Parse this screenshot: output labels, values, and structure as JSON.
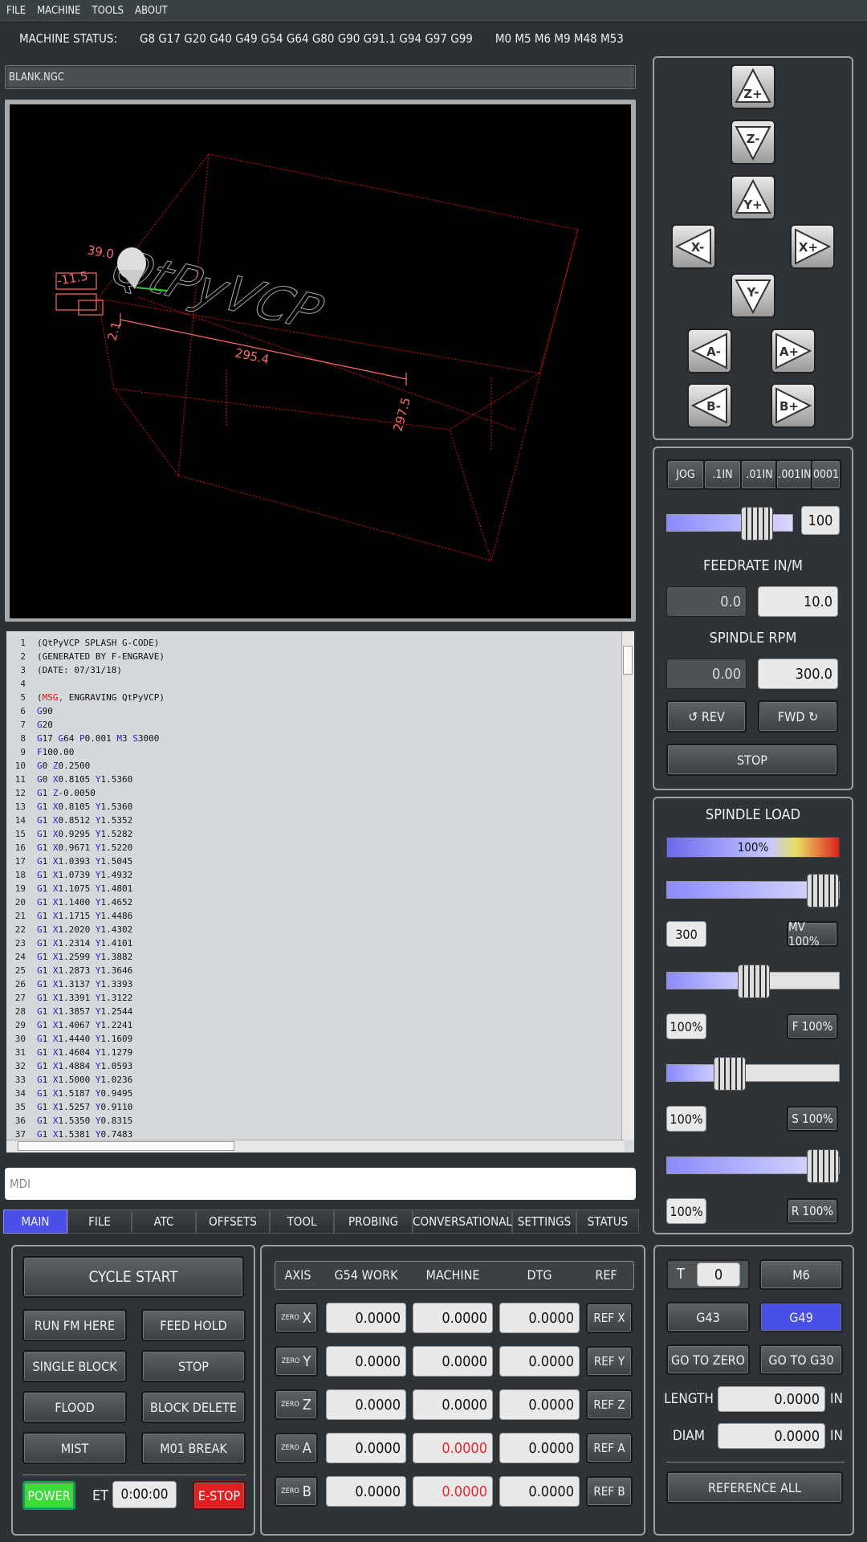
{
  "menu": [
    "FILE",
    "MACHINE",
    "TOOLS",
    "ABOUT"
  ],
  "status": {
    "label": "MACHINE STATUS:",
    "gcodes": "G8 G17 G20 G40 G49 G54 G64 G80 G90 G91.1 G94 G97 G99",
    "mcodes": "M0 M5 M6 M9 M48 M53"
  },
  "file_name": "BLANK.NGC",
  "preview": {
    "text": "QtPyVCP",
    "dims": [
      "39.0",
      "-11.5",
      "295.4",
      "297.5",
      "2.1"
    ]
  },
  "code_lines": [
    {
      "n": "1",
      "t": "(QtPyVCP SPLASH G-CODE)"
    },
    {
      "n": "2",
      "t": "(GENERATED BY F-ENGRAVE)"
    },
    {
      "n": "3",
      "t": "(DATE: 07/31/18)"
    },
    {
      "n": "4",
      "t": ""
    },
    {
      "n": "5",
      "t": "(MSG, ENGRAVING QtPyVCP)"
    },
    {
      "n": "6",
      "t": "G90"
    },
    {
      "n": "7",
      "t": "G20"
    },
    {
      "n": "8",
      "t": "G17 G64 P0.001 M3 S3000"
    },
    {
      "n": "9",
      "t": "F100.00"
    },
    {
      "n": "10",
      "t": "G0 Z0.2500"
    },
    {
      "n": "11",
      "t": "G0 X0.8105 Y1.5360"
    },
    {
      "n": "12",
      "t": "G1 Z-0.0050"
    },
    {
      "n": "13",
      "t": "G1 X0.8105 Y1.5360"
    },
    {
      "n": "14",
      "t": "G1 X0.8512 Y1.5352"
    },
    {
      "n": "15",
      "t": "G1 X0.9295 Y1.5282"
    },
    {
      "n": "16",
      "t": "G1 X0.9671 Y1.5220"
    },
    {
      "n": "17",
      "t": "G1 X1.0393 Y1.5045"
    },
    {
      "n": "18",
      "t": "G1 X1.0739 Y1.4932"
    },
    {
      "n": "19",
      "t": "G1 X1.1075 Y1.4801"
    },
    {
      "n": "20",
      "t": "G1 X1.1400 Y1.4652"
    },
    {
      "n": "21",
      "t": "G1 X1.1715 Y1.4486"
    },
    {
      "n": "22",
      "t": "G1 X1.2020 Y1.4302"
    },
    {
      "n": "23",
      "t": "G1 X1.2314 Y1.4101"
    },
    {
      "n": "24",
      "t": "G1 X1.2599 Y1.3882"
    },
    {
      "n": "25",
      "t": "G1 X1.2873 Y1.3646"
    },
    {
      "n": "26",
      "t": "G1 X1.3137 Y1.3393"
    },
    {
      "n": "27",
      "t": "G1 X1.3391 Y1.3122"
    },
    {
      "n": "28",
      "t": "G1 X1.3857 Y1.2544"
    },
    {
      "n": "29",
      "t": "G1 X1.4067 Y1.2241"
    },
    {
      "n": "30",
      "t": "G1 X1.4440 Y1.1609"
    },
    {
      "n": "31",
      "t": "G1 X1.4604 Y1.1279"
    },
    {
      "n": "32",
      "t": "G1 X1.4884 Y1.0593"
    },
    {
      "n": "33",
      "t": "G1 X1.5000 Y1.0236"
    },
    {
      "n": "34",
      "t": "G1 X1.5187 Y0.9495"
    },
    {
      "n": "35",
      "t": "G1 X1.5257 Y0.9110"
    },
    {
      "n": "36",
      "t": "G1 X1.5350 Y0.8315"
    },
    {
      "n": "37",
      "t": "G1 X1.5381 Y0.7483"
    }
  ],
  "mdi_placeholder": "MDI",
  "tabs": [
    "MAIN",
    "FILE",
    "ATC",
    "OFFSETS",
    "TOOL",
    "PROBING",
    "CONVERSATIONAL",
    "SETTINGS",
    "STATUS"
  ],
  "jog_buttons": [
    "Z+",
    "Z-",
    "Y+",
    "X-",
    "X+",
    "Y-",
    "A-",
    "A+",
    "B-",
    "B+"
  ],
  "increments": [
    "JOG",
    ".1IN",
    ".01IN",
    ".001IN",
    "0001"
  ],
  "jog_speed": "100",
  "feedrate": {
    "label": "FEEDRATE IN/M",
    "actual": "0.0",
    "set": "10.0"
  },
  "spindle": {
    "label": "SPINDLE RPM",
    "actual": "0.00",
    "set": "300.0",
    "rev": "REV",
    "fwd": "FWD",
    "stop": "STOP"
  },
  "spindle_load": {
    "label": "SPINDLE LOAD",
    "value": "100%"
  },
  "overrides": [
    {
      "value": "300",
      "button": "MV 100%"
    },
    {
      "value": "100%",
      "button": "F 100%"
    },
    {
      "value": "100%",
      "button": "S 100%"
    },
    {
      "value": "100%",
      "button": "R 100%"
    }
  ],
  "controls": {
    "cycle_start": "CYCLE START",
    "run_from_here": "RUN FM HERE",
    "feed_hold": "FEED HOLD",
    "single_block": "SINGLE BLOCK",
    "stop": "STOP",
    "flood": "FLOOD",
    "block_delete": "BLOCK DELETE",
    "mist": "MIST",
    "m01_break": "M01 BREAK",
    "power": "POWER",
    "et_label": "ET",
    "et_value": "0:00:00",
    "estop": "E-STOP"
  },
  "dro": {
    "headers": [
      "AXIS",
      "G54 WORK",
      "MACHINE",
      "DTG",
      "REF"
    ],
    "zero_label": "ZERO",
    "rows": [
      {
        "axis": "X",
        "work": "0.0000",
        "machine": "0.0000",
        "dtg": "0.0000",
        "ref": "REF X"
      },
      {
        "axis": "Y",
        "work": "0.0000",
        "machine": "0.0000",
        "dtg": "0.0000",
        "ref": "REF Y"
      },
      {
        "axis": "Z",
        "work": "0.0000",
        "machine": "0.0000",
        "dtg": "0.0000",
        "ref": "REF Z"
      },
      {
        "axis": "A",
        "work": "0.0000",
        "machine": "0.0000",
        "dtg": "0.0000",
        "ref": "REF A"
      },
      {
        "axis": "B",
        "work": "0.0000",
        "machine": "0.0000",
        "dtg": "0.0000",
        "ref": "REF B"
      }
    ]
  },
  "tool": {
    "t_label": "T",
    "t_value": "0",
    "m6": "M6",
    "g43": "G43",
    "g49": "G49",
    "go_zero": "GO TO ZERO",
    "go_g30": "GO TO G30",
    "length_label": "LENGTH",
    "length_value": "0.0000",
    "diam_label": "DIAM",
    "diam_value": "0.0000",
    "unit": "IN",
    "reference_all": "REFERENCE ALL"
  }
}
